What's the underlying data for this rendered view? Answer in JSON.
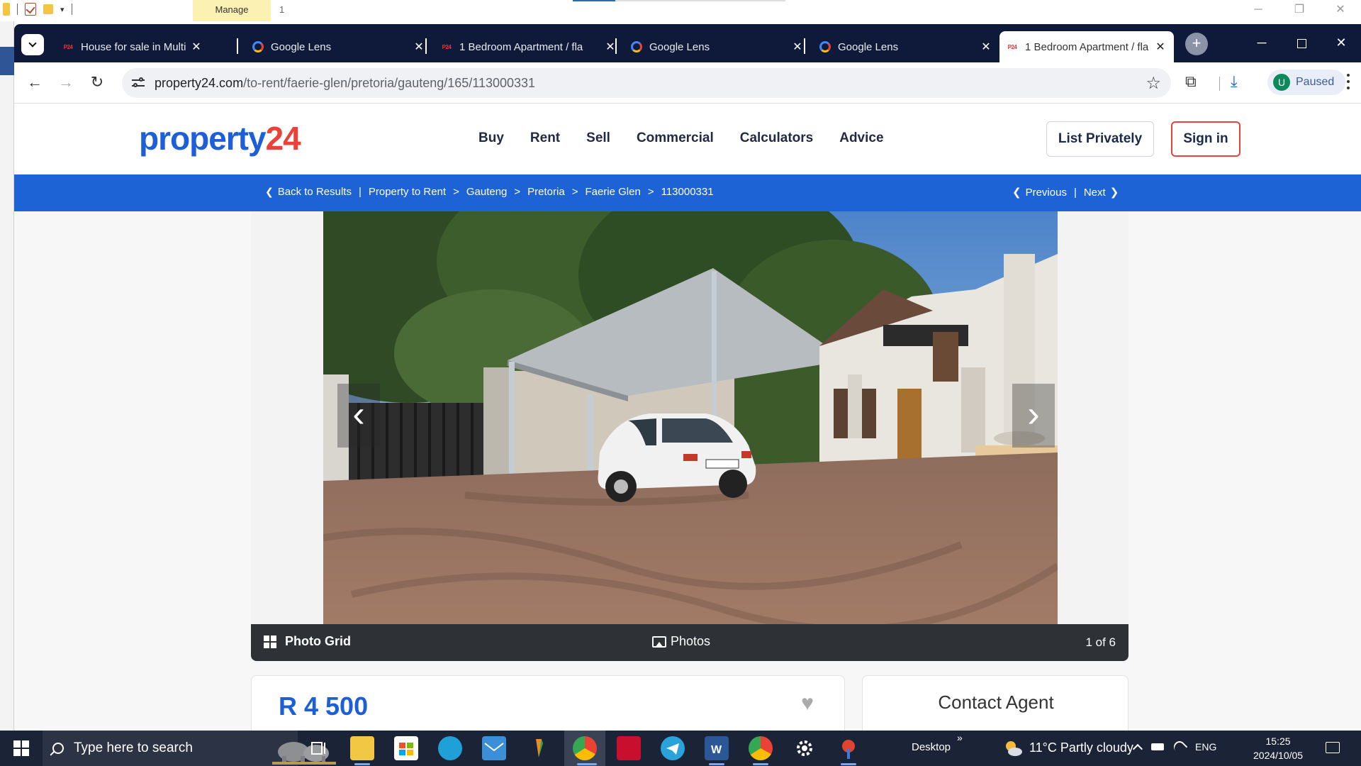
{
  "explorer": {
    "manage_tab": "Manage",
    "ribbon_number": "1"
  },
  "browser": {
    "tabs": [
      {
        "title": "House for sale in Multiple S",
        "favicon": "property24-icon"
      },
      {
        "title": "Google Lens",
        "favicon": "google-lens-icon"
      },
      {
        "title": "1 Bedroom Apartment / fla",
        "favicon": "property24-icon"
      },
      {
        "title": "Google Lens",
        "favicon": "google-lens-icon"
      },
      {
        "title": "Google Lens",
        "favicon": "google-lens-icon"
      },
      {
        "title": "1 Bedroom Apartment / fla",
        "favicon": "property24-icon",
        "active": true
      }
    ],
    "favicon_text": "P24",
    "url_host": "property24.com",
    "url_path": "/to-rent/faerie-glen/pretoria/gauteng/165/113000331",
    "profile_initial": "U",
    "profile_status": "Paused"
  },
  "site": {
    "logo_main": "property",
    "logo_accent": "24",
    "brand_blue": "#1d5fd6",
    "brand_red": "#e9423a",
    "nav": [
      "Buy",
      "Rent",
      "Sell",
      "Commercial",
      "Calculators",
      "Advice"
    ],
    "list_privately": "List Privately",
    "sign_in": "Sign in"
  },
  "breadcrumb": {
    "back": "Back to Results",
    "items": [
      "Property to Rent",
      "Gauteng",
      "Pretoria",
      "Faerie Glen",
      "113000331"
    ],
    "bar_sep": "|",
    "crumb_sep": ">",
    "previous": "Previous",
    "next": "Next"
  },
  "gallery": {
    "photo_grid": "Photo Grid",
    "photos": "Photos",
    "count": "1 of 6"
  },
  "listing": {
    "price": "R 4 500",
    "contact_agent": "Contact Agent"
  },
  "taskbar": {
    "search_placeholder": "Type here to search",
    "desktop": "Desktop",
    "desktop_chevron": "»",
    "weather": "11°C  Partly cloudy",
    "language": "ENG",
    "time": "15:25",
    "date": "2024/10/05"
  }
}
